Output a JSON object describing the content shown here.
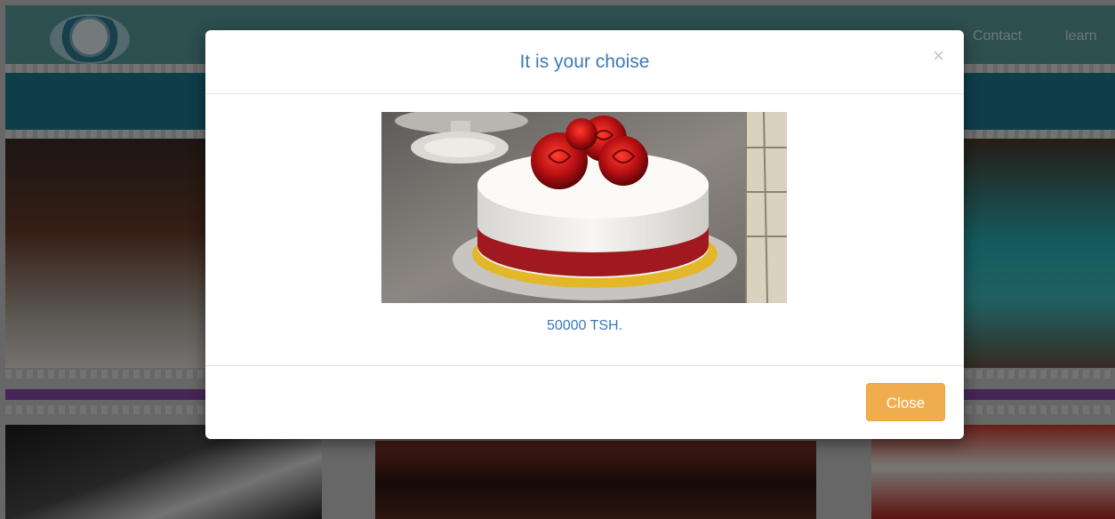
{
  "navbar": {
    "links": [
      "Contact",
      "learn"
    ]
  },
  "modal": {
    "title": "It is your choise",
    "close_symbol": "×",
    "price": "50000 TSH.",
    "close_button_label": "Close"
  },
  "colors": {
    "accent": "#3e7ab5",
    "close_button": "#f0ad4e",
    "navbar": "#5c9f9f",
    "banner": "#1d7c94",
    "stripe": "#8e4bb0"
  }
}
